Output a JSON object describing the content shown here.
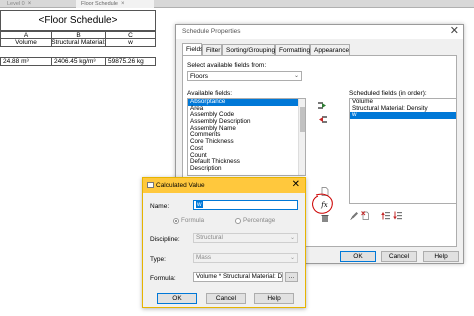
{
  "view_tabs": [
    {
      "label": "Level 0"
    },
    {
      "label": "Floor Schedule"
    }
  ],
  "schedule": {
    "title": "<Floor Schedule>",
    "column_letters": [
      "A",
      "B",
      "C"
    ],
    "headers": [
      "Volume",
      "Structural Material:",
      "w"
    ],
    "rows": [
      [
        "24.88 m³",
        "2406.45 kg/m³",
        "59875.26 kg"
      ]
    ]
  },
  "schedule_properties": {
    "title": "Schedule Properties",
    "close_glyph": "✕",
    "tabs": [
      {
        "label": "Fields"
      },
      {
        "label": "Filter"
      },
      {
        "label": "Sorting/Grouping"
      },
      {
        "label": "Formatting"
      },
      {
        "label": "Appearance"
      }
    ],
    "select_from_label": "Select available fields from:",
    "select_from_value": "Floors",
    "available_label": "Available fields:",
    "available_fields": [
      "Absorptance",
      "Area",
      "Assembly Code",
      "Assembly Description",
      "Assembly Name",
      "Comments",
      "Core Thickness",
      "Cost",
      "Count",
      "Default Thickness",
      "Description"
    ],
    "available_selected_index": 0,
    "scheduled_label": "Scheduled fields (in order):",
    "scheduled_fields": [
      "Volume",
      "Structural Material: Density",
      "w"
    ],
    "scheduled_selected_index": 2,
    "buttons": {
      "ok": "OK",
      "cancel": "Cancel",
      "help": "Help"
    },
    "icons": [
      "add-field-icon",
      "remove-field-icon",
      "add-parameter-icon",
      "calculated-value-icon",
      "delete-parameter-icon",
      "edit-icon",
      "move-up-icon",
      "move-down-icon"
    ]
  },
  "calculated_value": {
    "title": "Calculated Value",
    "close_glyph": "✕",
    "name_label": "Name:",
    "name_value": "w",
    "formula_radio_label": "Formula",
    "percentage_radio_label": "Percentage",
    "discipline_label": "Discipline:",
    "discipline_value": "Structural",
    "type_label": "Type:",
    "type_value": "Mass",
    "formula_label": "Formula:",
    "formula_value": "Volume * Structural Material: Den",
    "ellipsis": "...",
    "buttons": {
      "ok": "OK",
      "cancel": "Cancel",
      "help": "Help"
    }
  },
  "colors": {
    "selection": "#0078d7",
    "dialog_title": "#ffc83d",
    "annotation": "#cc0000"
  }
}
